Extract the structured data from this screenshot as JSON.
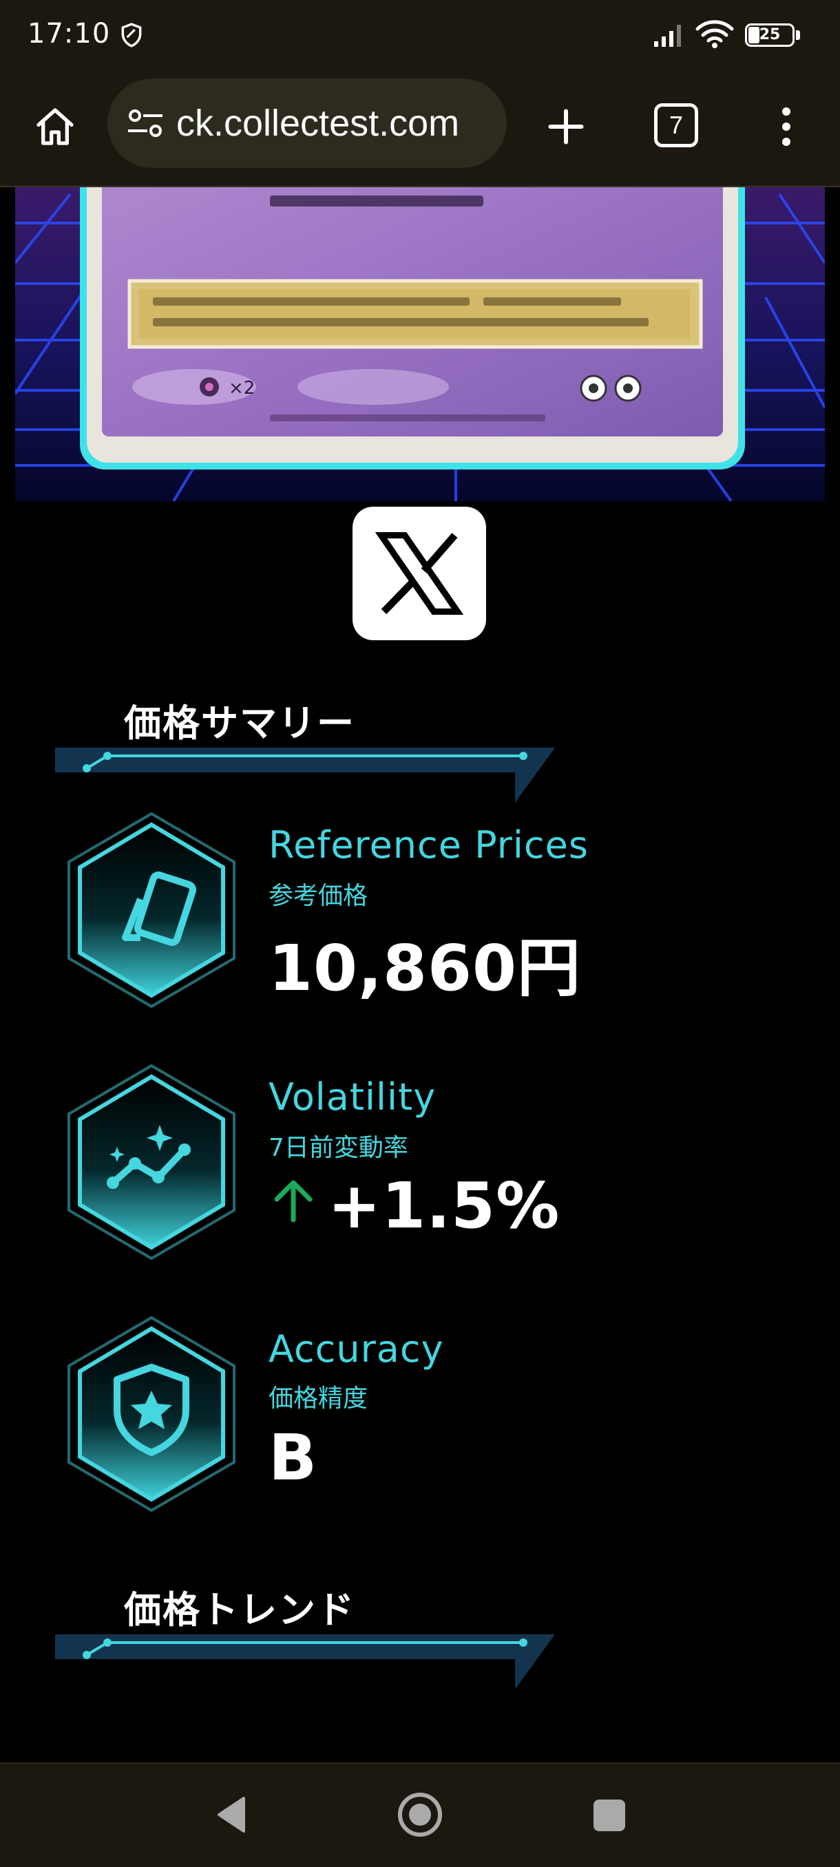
{
  "status_bar": {
    "time": "17:10",
    "battery_level": "25",
    "icons": [
      "shield-icon",
      "signal-icon",
      "wifi-icon",
      "battery-icon"
    ]
  },
  "browser": {
    "url": "ck.collectest.com",
    "tab_count": "7",
    "icons": [
      "home-icon",
      "site-settings-icon",
      "new-tab-icon",
      "tab-switcher-icon",
      "more-menu-icon"
    ]
  },
  "share": {
    "icon": "x-logo-icon"
  },
  "price_summary": {
    "title": "価格サマリー",
    "metrics": [
      {
        "label_en": "Reference Prices",
        "label_ja": "参考価格",
        "value": "10,860円",
        "icon": "card-icon"
      },
      {
        "label_en": "Volatility",
        "label_ja": "7日前変動率",
        "value": "+1.5%",
        "icon": "trend-chart-icon",
        "trend": "up",
        "trend_color": "#1ea85a"
      },
      {
        "label_en": "Accuracy",
        "label_ja": "価格精度",
        "value": "B",
        "icon": "shield-star-icon"
      }
    ]
  },
  "price_trend": {
    "title": "価格トレンド"
  },
  "theme": {
    "accent": "#45d6df",
    "background": "#000000"
  },
  "nav_bar": {
    "icons": [
      "back-icon",
      "home-circle-icon",
      "recents-icon"
    ]
  }
}
